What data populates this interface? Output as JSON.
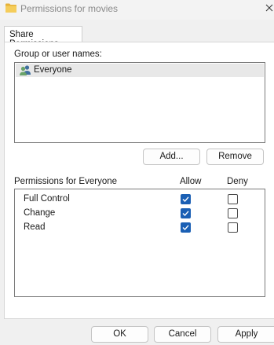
{
  "window": {
    "title": "Permissions for movies"
  },
  "tabs": [
    {
      "label": "Share Permissions",
      "active": true
    }
  ],
  "group_section": {
    "label": "Group or user names:",
    "users": [
      {
        "name": "Everyone",
        "icon": "users-icon",
        "selected": true
      }
    ],
    "add_button": "Add...",
    "remove_button": "Remove"
  },
  "permissions_section": {
    "label": "Permissions for Everyone",
    "allow_header": "Allow",
    "deny_header": "Deny",
    "rows": [
      {
        "name": "Full Control",
        "allow": true,
        "deny": false
      },
      {
        "name": "Change",
        "allow": true,
        "deny": false
      },
      {
        "name": "Read",
        "allow": true,
        "deny": false
      }
    ]
  },
  "footer": {
    "ok": "OK",
    "cancel": "Cancel",
    "apply": "Apply"
  },
  "colors": {
    "checkbox_checked": "#1a5fb4",
    "selection": "#e8e8e8",
    "folder": "#f2c44b"
  }
}
